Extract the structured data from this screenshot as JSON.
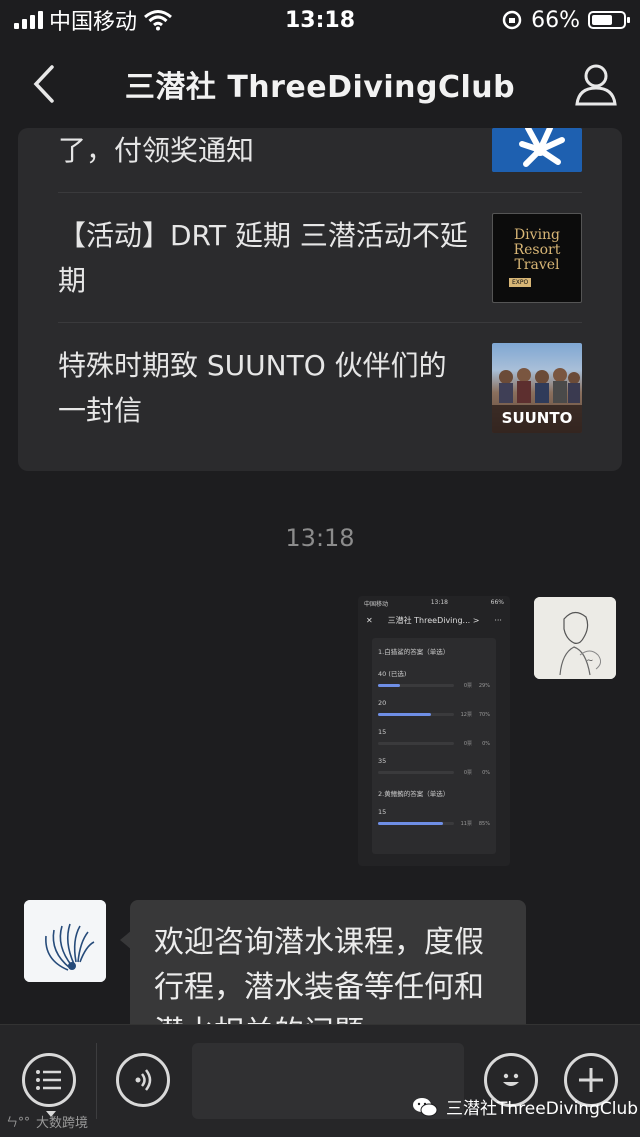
{
  "status_bar": {
    "carrier": "中国移动",
    "time": "13:18",
    "battery_percent": "66%",
    "battery_level": 0.66
  },
  "nav": {
    "title": "三潜社 ThreeDivingClub"
  },
  "articles": [
    {
      "title": "了，付领奖通知",
      "thumb_icon": "blue-logo-thumbnail"
    },
    {
      "title": "【活动】DRT 延期 三潜活动不延期",
      "thumb_text": [
        "Diving",
        "Resort",
        "Travel"
      ],
      "thumb_badge": "EXPO",
      "thumb_icon": "diving-resort-travel-expo-thumbnail"
    },
    {
      "title": "特殊时期致 SUUNTO 伙伴们的一封信",
      "thumb_text": [
        "SUUNTO"
      ],
      "thumb_icon": "suunto-group-photo-thumbnail"
    }
  ],
  "chat": {
    "timestamp": "13:18",
    "sent_image": {
      "status_carrier": "中国移动",
      "status_time": "13:18",
      "status_battery": "66%",
      "title": "三潜社 ThreeDiving... >",
      "q1": "1.白猎鲨的答案（单选）",
      "options": [
        {
          "label": "40 (已选)",
          "votes": "0票",
          "percent": "29%",
          "level": 0.29
        },
        {
          "label": "20",
          "votes": "12票",
          "percent": "70%",
          "level": 0.7
        },
        {
          "label": "15",
          "votes": "0票",
          "percent": "0%",
          "level": 0
        },
        {
          "label": "35",
          "votes": "0票",
          "percent": "0%",
          "level": 0
        }
      ],
      "q2": "2.黄鳍鲔的答案（单选）",
      "q2_options": [
        {
          "label": "15",
          "votes": "11票",
          "percent": "85%",
          "level": 0.85
        }
      ]
    },
    "received_message": "欢迎咨询潜水课程，度假行程，潜水装备等任何和潜水相关的问题"
  },
  "toolbar": {
    "icons": [
      "menu-list-icon",
      "voice-icon",
      "emoji-icon",
      "plus-icon"
    ]
  },
  "watermarks": {
    "left": "大数跨境",
    "right": "三潜社ThreeDivingClub"
  },
  "colors": {
    "background": "#1d1d1f",
    "card": "#2b2b2d",
    "bubble": "#383839",
    "progress": "#6f8fe6"
  }
}
